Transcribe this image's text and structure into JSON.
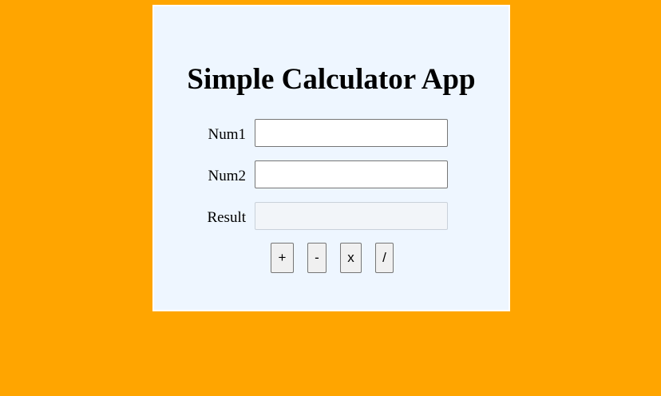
{
  "app": {
    "title": "Simple Calculator App"
  },
  "form": {
    "num1": {
      "label": "Num1",
      "value": "",
      "placeholder": ""
    },
    "num2": {
      "label": "Num2",
      "value": "",
      "placeholder": ""
    },
    "result": {
      "label": "Result",
      "value": "",
      "placeholder": ""
    }
  },
  "buttons": {
    "add": "+",
    "subtract": "-",
    "multiply": "x",
    "divide": "/"
  },
  "colors": {
    "page_background": "#FFA500",
    "card_background": "#EEF6FF",
    "card_border": "#FFFFFF"
  }
}
